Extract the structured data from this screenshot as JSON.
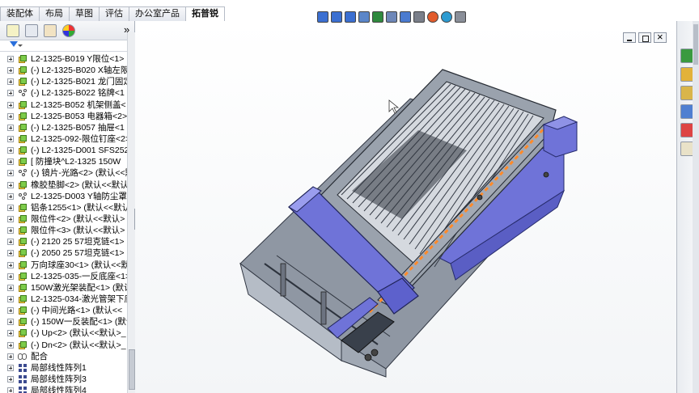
{
  "command_tabs": [
    {
      "label": "装配体",
      "active": false
    },
    {
      "label": "布局",
      "active": false
    },
    {
      "label": "草图",
      "active": false
    },
    {
      "label": "评估",
      "active": false
    },
    {
      "label": "办公室产品",
      "active": false
    },
    {
      "label": "拓普锐",
      "active": true
    }
  ],
  "panel_tabs": [
    "feature-manager",
    "property-manager",
    "configuration-manager",
    "display-manager"
  ],
  "panel_expand_glyph": "»",
  "tree": [
    {
      "label": "L2-1325-B019  Y限位<1>",
      "icon": "part"
    },
    {
      "label": "(-) L2-1325-B020  X轴左限",
      "icon": "part"
    },
    {
      "label": "(-) L2-1325-B021  龙门固定",
      "icon": "part"
    },
    {
      "label": "(-) L2-1325-B022  铭牌<1",
      "icon": "subassembly"
    },
    {
      "label": "L2-1325-B052  机架侧盖<",
      "icon": "part"
    },
    {
      "label": "L2-1325-B053  电器箱<2>",
      "icon": "part"
    },
    {
      "label": "(-) L2-1325-B057  抽屉<1",
      "icon": "part"
    },
    {
      "label": "L2-1325-092-限位钉座<2>",
      "icon": "part"
    },
    {
      "label": "(-) L2-1325-D001  SFS252",
      "icon": "part"
    },
    {
      "label": "[ 防撞块^L2-1325  150W",
      "icon": "part"
    },
    {
      "label": "(-) 镜片-光路<2> (默认<<默",
      "icon": "subassembly"
    },
    {
      "label": "橡胶垫脚<2> (默认<<默认",
      "icon": "part"
    },
    {
      "label": "L2-1325-D003 Y轴防尘罩2",
      "icon": "subassembly"
    },
    {
      "label": "铝条1255<1> (默认<<默认",
      "icon": "part"
    },
    {
      "label": "限位件<2> (默认<<默认>",
      "icon": "part"
    },
    {
      "label": "限位件<3> (默认<<默认>",
      "icon": "part"
    },
    {
      "label": "(-) 2120  25 57坦克链<1>",
      "icon": "part"
    },
    {
      "label": "(-) 2050  25 57坦克链<1>",
      "icon": "part"
    },
    {
      "label": "万向球座30<1> (默认<<默",
      "icon": "part"
    },
    {
      "label": "L2-1325-035-一反底座<1>",
      "icon": "part"
    },
    {
      "label": "150W激光架装配<1> (默认",
      "icon": "part"
    },
    {
      "label": "L2-1325-034-激光管架下底",
      "icon": "part"
    },
    {
      "label": "(-) 中间光路<1> (默认<<",
      "icon": "part"
    },
    {
      "label": "(-) 150W一反装配<1> (默认",
      "icon": "part"
    },
    {
      "label": "(-) Up<2> (默认<<默认>_",
      "icon": "part"
    },
    {
      "label": "(-) Dn<2> (默认<<默认>_",
      "icon": "part"
    },
    {
      "label": "配合",
      "icon": "mate"
    },
    {
      "label": "局部线性阵列1",
      "icon": "pattern"
    },
    {
      "label": "局部线性阵列3",
      "icon": "pattern"
    },
    {
      "label": "局部线性阵列4",
      "icon": "pattern"
    }
  ],
  "heads_up_toolbar": [
    "zoom-to-fit-icon",
    "zoom-to-area-icon",
    "previous-view-icon",
    "section-view-icon",
    "dynamic-annotation-icon",
    "view-orientation-icon",
    "display-style-icon",
    "hide-show-icon",
    "edit-appearance-icon",
    "apply-scene-icon",
    "view-settings-icon"
  ],
  "task_pane": [
    "solidworks-resources-icon",
    "design-library-icon",
    "file-explorer-icon",
    "view-palette-icon",
    "appearances-icon",
    "custom-properties-icon"
  ],
  "colors": {
    "machine_body": "#6f73d8",
    "machine_frame": "#7f8896",
    "laser_path": "#ff8a2a",
    "part_icon": "#7dcc4a"
  }
}
